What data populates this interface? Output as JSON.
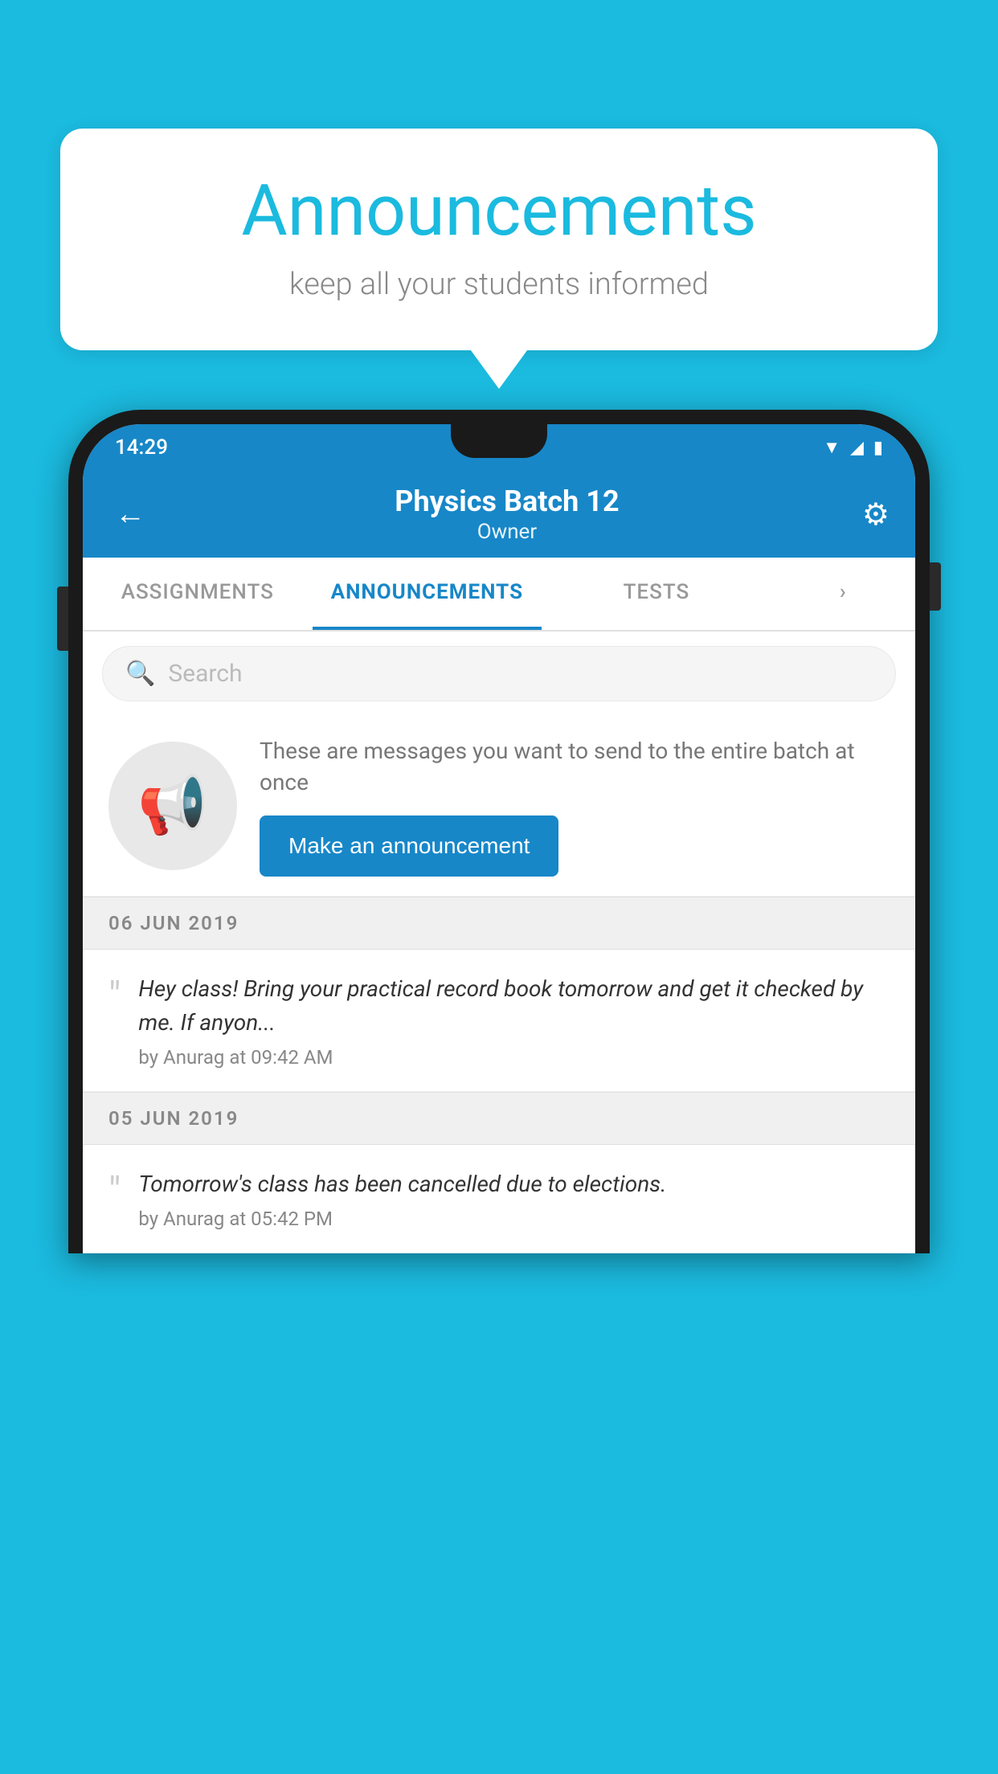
{
  "background_color": "#1BBADF",
  "speech_bubble": {
    "title": "Announcements",
    "subtitle": "keep all your students informed"
  },
  "phone": {
    "status_bar": {
      "time": "14:29"
    },
    "app_bar": {
      "back_label": "←",
      "title": "Physics Batch 12",
      "subtitle": "Owner",
      "settings_label": "⚙"
    },
    "tabs": [
      {
        "label": "ASSIGNMENTS",
        "active": false
      },
      {
        "label": "ANNOUNCEMENTS",
        "active": true
      },
      {
        "label": "TESTS",
        "active": false
      },
      {
        "label": "›",
        "active": false,
        "partial": true
      }
    ],
    "search": {
      "placeholder": "Search"
    },
    "promo": {
      "text": "These are messages you want to send to the entire batch at once",
      "button_label": "Make an announcement"
    },
    "announcements": [
      {
        "date": "06  JUN  2019",
        "text": "Hey class! Bring your practical record book tomorrow and get it checked by me. If anyon...",
        "meta": "by Anurag at 09:42 AM"
      },
      {
        "date": "05  JUN  2019",
        "text": "Tomorrow's class has been cancelled due to elections.",
        "meta": "by Anurag at 05:42 PM"
      }
    ]
  }
}
